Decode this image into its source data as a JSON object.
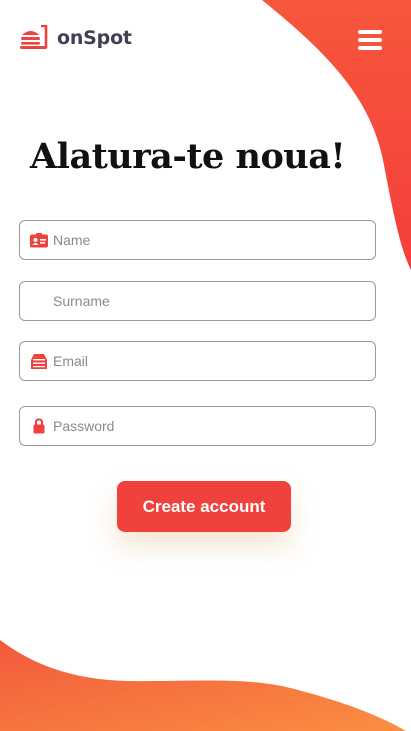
{
  "brand": {
    "name": "onSpot"
  },
  "menu": {
    "icon": "hamburger-menu-icon"
  },
  "heading": "Alatura-te noua!",
  "form": {
    "name": {
      "placeholder": "Name",
      "value": "",
      "icon": "id-card-icon"
    },
    "surname": {
      "placeholder": "Surname",
      "value": ""
    },
    "email": {
      "placeholder": "Email",
      "value": "",
      "icon": "inbox-icon"
    },
    "password": {
      "placeholder": "Password",
      "value": "",
      "icon": "lock-icon"
    }
  },
  "submit": {
    "label": "Create account"
  },
  "colors": {
    "accent": "#f1413d",
    "gradient_top": "#f4413a",
    "gradient_bottom": "#fb8a3f",
    "brand_text": "#453d53"
  }
}
